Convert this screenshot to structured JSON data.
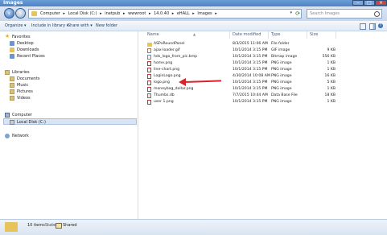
{
  "window": {
    "title": "Images"
  },
  "address": {
    "crumbs": [
      "Computer",
      "▸",
      "Local Disk (C:)",
      "▸",
      "inetpub",
      "▸",
      "wwwroot",
      "▸",
      "14.0.40",
      "▸",
      "eHALL",
      "▸",
      "Images",
      "▸"
    ],
    "search_placeholder": "Search Images"
  },
  "toolbar": {
    "organize": "Organize ▾",
    "include": "Include in library ▾",
    "share": "Share with ▾",
    "new_folder": "New folder"
  },
  "nav": {
    "favorites": "Favorites",
    "desktop": "Desktop",
    "downloads": "Downloads",
    "recent": "Recent Places",
    "libraries": "Libraries",
    "documents": "Documents",
    "music": "Music",
    "pictures": "Pictures",
    "videos": "Videos",
    "computer": "Computer",
    "localdisk": "Local Disk (C:)",
    "network": "Network"
  },
  "columns": {
    "name": "Name",
    "date": "Date modified",
    "type": "Type",
    "size": "Size"
  },
  "files": [
    {
      "name": "ASPxRoundPanel",
      "date": "8/3/2015 11:06 AM",
      "type": "File folder",
      "size": "",
      "icon": "folder"
    },
    {
      "name": "ajax-loader.gif",
      "date": "10/1/2014 3:15 PM",
      "type": "GIF image",
      "size": "9 KB",
      "icon": "gif"
    },
    {
      "name": "hds_logo_from_pic.bmp",
      "date": "10/1/2014 3:15 PM",
      "type": "Bitmap image",
      "size": "556 KB",
      "icon": "bmp"
    },
    {
      "name": "home.png",
      "date": "10/1/2014 3:15 PM",
      "type": "PNG image",
      "size": "1 KB",
      "icon": "png"
    },
    {
      "name": "line-chart.png",
      "date": "10/1/2014 3:15 PM",
      "type": "PNG image",
      "size": "1 KB",
      "icon": "png"
    },
    {
      "name": "LoginLogo.png",
      "date": "4/30/2014 10:08 AM",
      "type": "PNG image",
      "size": "16 KB",
      "icon": "png"
    },
    {
      "name": "logo.png",
      "date": "10/1/2014 3:15 PM",
      "type": "PNG image",
      "size": "5 KB",
      "icon": "png"
    },
    {
      "name": "moneybag_dollar.png",
      "date": "10/1/2014 3:15 PM",
      "type": "PNG image",
      "size": "1 KB",
      "icon": "png"
    },
    {
      "name": "Thumbs.db",
      "date": "7/7/2015 10:44 AM",
      "type": "Data Base File",
      "size": "18 KB",
      "icon": "db"
    },
    {
      "name": "user 1.png",
      "date": "10/1/2014 3:15 PM",
      "type": "PNG image",
      "size": "1 KB",
      "icon": "png"
    }
  ],
  "status": {
    "count": "10 items",
    "state_label": "State:",
    "state_value": "Shared"
  },
  "colors": {
    "annotation_arrow": "#d8232a",
    "titlebar": "#4f82c4"
  }
}
